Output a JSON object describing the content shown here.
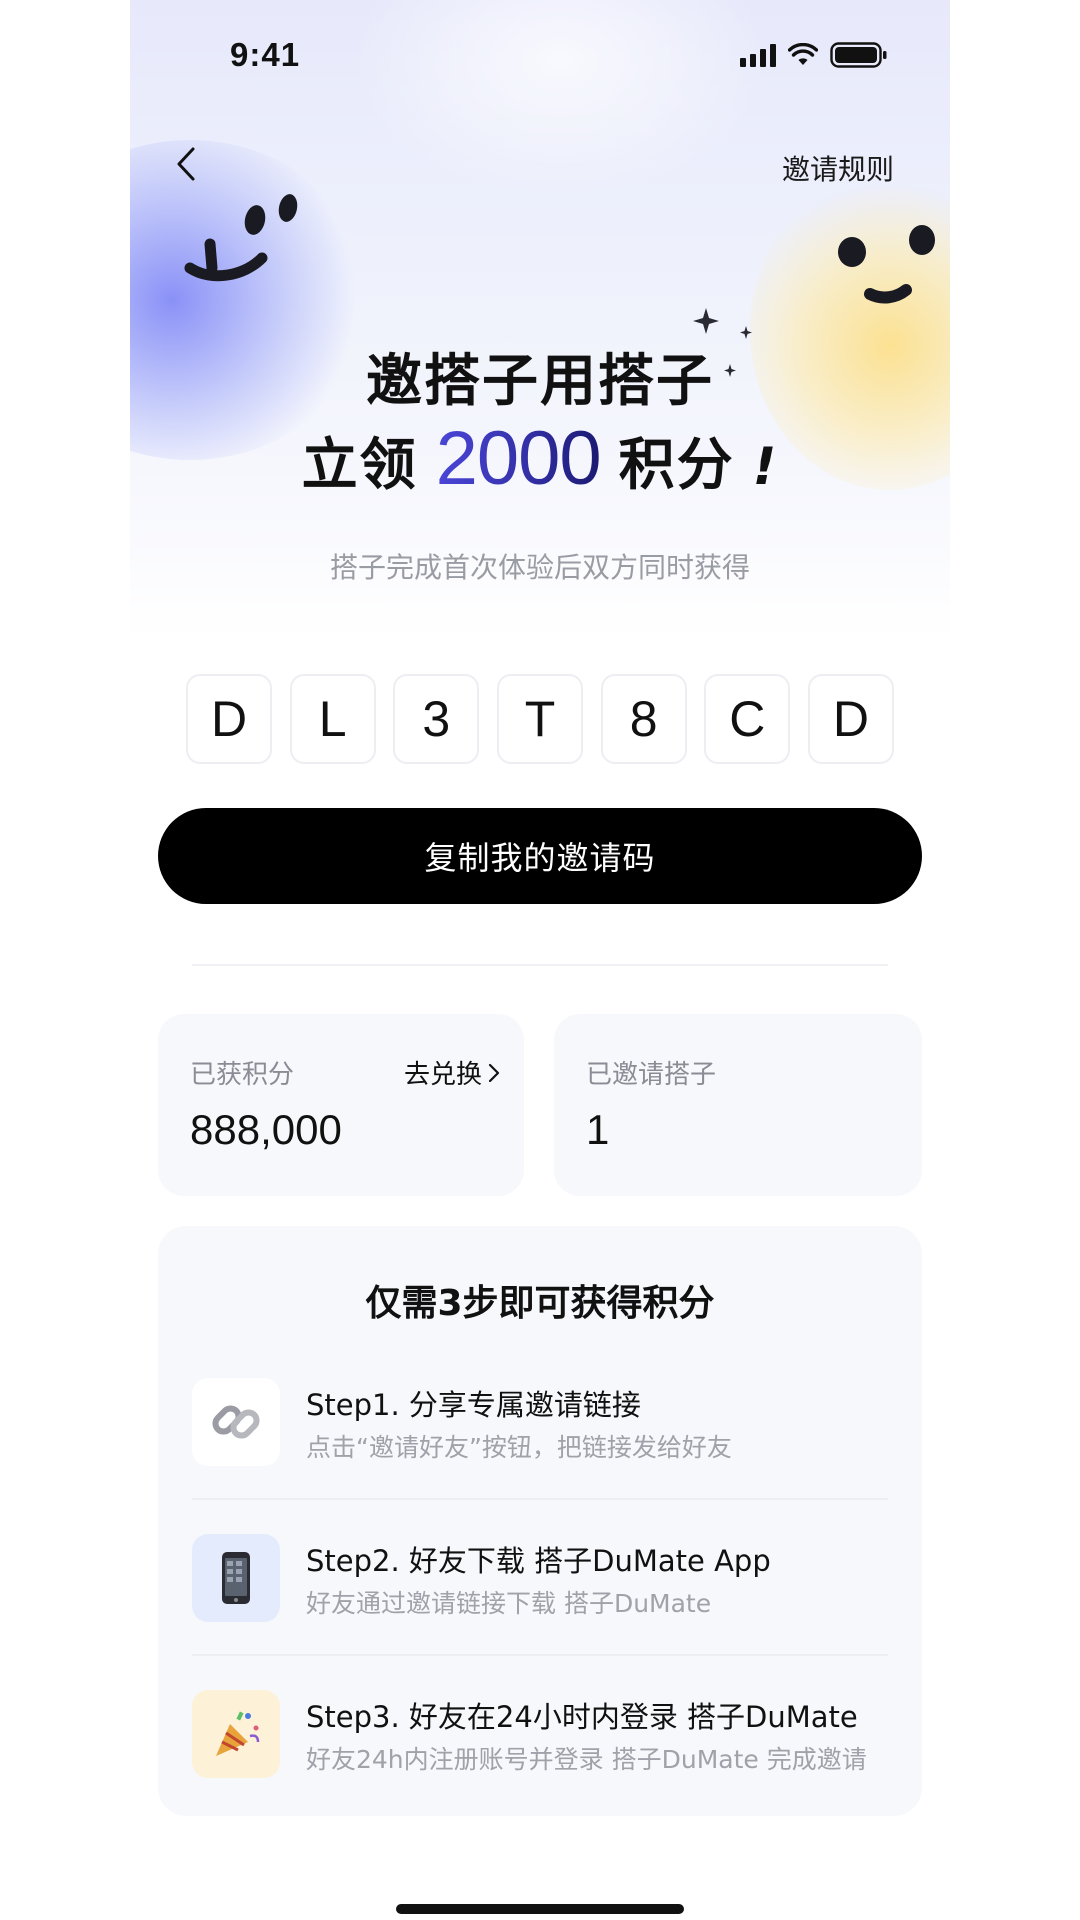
{
  "status_bar": {
    "time": "9:41"
  },
  "nav": {
    "rules_label": "邀请规则"
  },
  "hero": {
    "title_line1": "邀搭子用搭子",
    "title_prefix": "立领",
    "points": "2000",
    "title_suffix": "积分",
    "exclaim": "!",
    "subtitle": "搭子完成首次体验后双方同时获得"
  },
  "invite_code": [
    "D",
    "L",
    "3",
    "T",
    "8",
    "C",
    "D"
  ],
  "copy_button": {
    "label": "复制我的邀请码"
  },
  "stats": {
    "points_label": "已获积分",
    "points_value": "888,000",
    "redeem_label": "去兑换",
    "invited_label": "已邀请搭子",
    "invited_value": "1"
  },
  "steps": {
    "title": "仅需3步即可获得积分",
    "items": [
      {
        "icon": "link-icon",
        "heading": "Step1. 分享专属邀请链接",
        "desc": "点击“邀请好友”按钮，把链接发给好友"
      },
      {
        "icon": "mobile-phone-icon",
        "heading": "Step2. 好友下载 搭子DuMate App",
        "desc": "好友通过邀请链接下载 搭子DuMate"
      },
      {
        "icon": "party-popper-icon",
        "heading": "Step3. 好友在24小时内登录 搭子DuMate",
        "desc": "好友24h内注册账号并登录 搭子DuMate 完成邀请"
      }
    ]
  },
  "colors": {
    "accent_gradient_start": "#4a46d8",
    "accent_gradient_end": "#1a1a70",
    "button_bg": "#000000",
    "card_bg": "#f7f8fb"
  }
}
